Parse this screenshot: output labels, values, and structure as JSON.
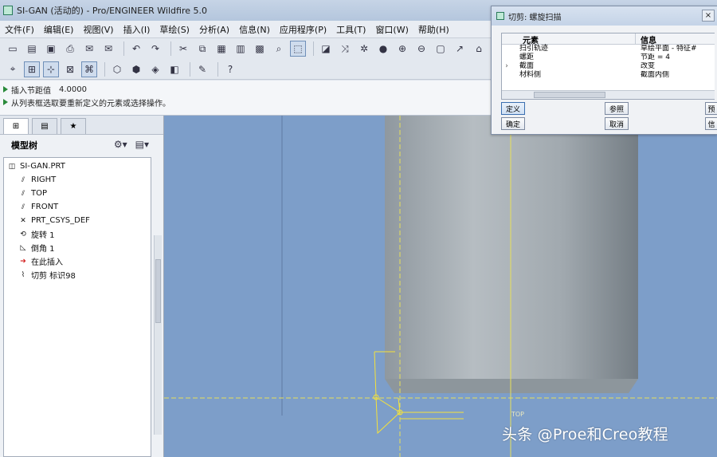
{
  "window": {
    "title": "SI-GAN (活动的) - Pro/ENGINEER Wildfire 5.0"
  },
  "menu": [
    "文件(F)",
    "编辑(E)",
    "视图(V)",
    "插入(I)",
    "草绘(S)",
    "分析(A)",
    "信息(N)",
    "应用程序(P)",
    "工具(T)",
    "窗口(W)",
    "帮助(H)"
  ],
  "messages": {
    "line1_label": "插入节距值",
    "line1_value": "4.0000",
    "line2": "从列表框选取要重新定义的元素或选择操作。"
  },
  "model_tree": {
    "header": "模型树",
    "items": [
      {
        "label": "SI-GAN.PRT",
        "icon": "part-icon",
        "level": 0
      },
      {
        "label": "RIGHT",
        "icon": "datum-plane-icon",
        "level": 1
      },
      {
        "label": "TOP",
        "icon": "datum-plane-icon",
        "level": 1
      },
      {
        "label": "FRONT",
        "icon": "datum-plane-icon",
        "level": 1
      },
      {
        "label": "PRT_CSYS_DEF",
        "icon": "csys-icon",
        "level": 1
      },
      {
        "label": "旋转 1",
        "icon": "revolve-icon",
        "level": 1
      },
      {
        "label": "倒角 1",
        "icon": "chamfer-icon",
        "level": 1
      },
      {
        "label": "在此插入",
        "icon": "insert-here-icon",
        "level": 1
      },
      {
        "label": "切剪 标识98",
        "icon": "cut-icon",
        "level": 1
      }
    ]
  },
  "dialog": {
    "title": "切剪: 螺旋扫描",
    "col_element": "元素",
    "col_info": "信息",
    "rows": [
      {
        "element": "扫引轨迹",
        "info": "草绘平面 - 特征#",
        "mark": ""
      },
      {
        "element": "螺距",
        "info": "节距 = 4",
        "mark": ""
      },
      {
        "element": "截面",
        "info": "改变",
        "mark": "›"
      },
      {
        "element": "材料侧",
        "info": "截面内侧",
        "mark": ""
      }
    ],
    "buttons": {
      "define": "定义",
      "refs": "参照",
      "preview": "预",
      "ok": "确定",
      "cancel": "取消",
      "info": "信"
    },
    "close": "×"
  },
  "viewport": {
    "top_label": "TOP",
    "watermark": "头条 @Proe和Creo教程"
  },
  "colors": {
    "viewport_bg": "#7d9ec9",
    "datum_yellow": "#e8e05a",
    "sketch_yellow": "#f5e23a"
  }
}
